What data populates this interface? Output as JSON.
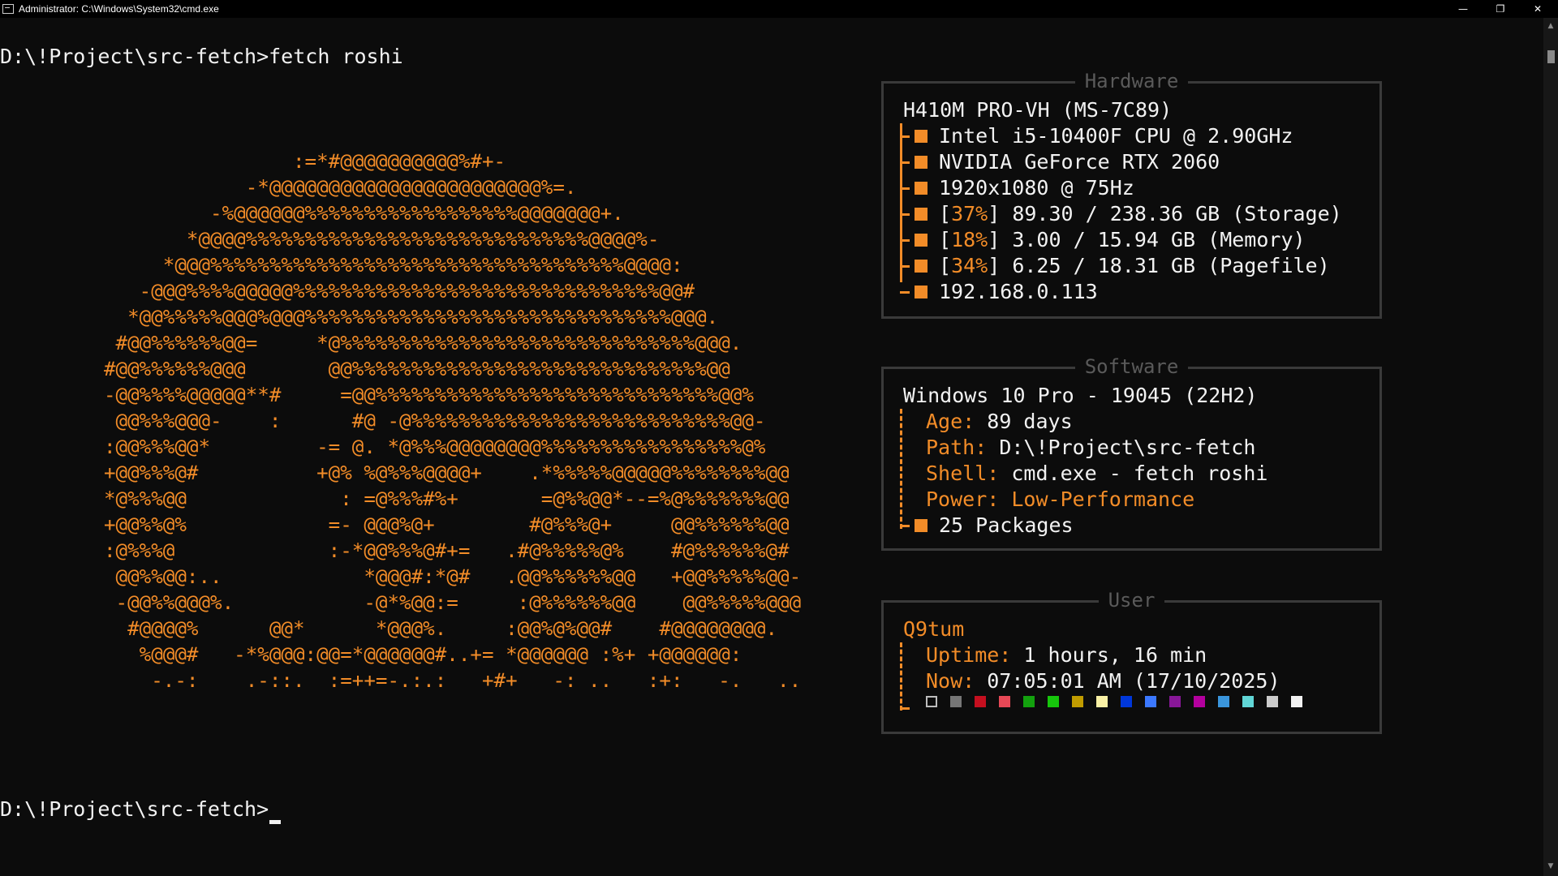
{
  "window": {
    "title": "Administrator: C:\\Windows\\System32\\cmd.exe",
    "min_glyph": "—",
    "max_glyph": "❐",
    "close_glyph": "✕"
  },
  "terminal": {
    "command_line": "D:\\!Project\\src-fetch>fetch roshi",
    "prompt": "D:\\!Project\\src-fetch>"
  },
  "ascii_art": "                :=*#@@@@@@@@@@%#+-\n            -*@@@@@@@@@@@@@@@@@@@@@@@%=.\n         -%@@@@@@%%%%%%%%%%%%%%%%%%@@@@@@@+.\n       *@@@@%%%%%%%%%%%%%%%%%%%%%%%%%%%%%@@@@%-\n     *@@@%%%%%%%%%%%%%%%%%%%%%%%%%%%%%%%%%%%@@@@:\n   -@@@%%%%@@@@@%%%%%%%%%%%%%%%%%%%%%%%%%%%%%%%@@#\n  *@@%%%%%@@@%@@@%%%%%%%%%%%%%%%%%%%%%%%%%%%%%%%@@@.\n #@@%%%%%%@@=     *@%%%%%%%%%%%%%%%%%%%%%%%%%%%%%%@@@.\n#@@%%%%%%@@@       @@%%%%%%%%%%%%%%%%%%%%%%%%%%%%%%@@\n-@@%%%%@@@@@**#     =@@%%%%%%%%%%%%%%%%%%%%%%%%%%%%%@@%\n @@%%%@@@-    :      #@ -@%%%%%%%%%%%%%%%%%%%%%%%%%%%@@-\n:@@%%%@@*         -= @. *@%%%@@@@@@@@%%%%%%%%%%%%%%%%%@%\n+@@%%%@#          +@% %@%%%@@@@+    .*%%%%%@@@@@%%%%%%%%@@\n*@%%%@@             : =@%%%#%+       =@%%@@*--=%@%%%%%%%@@\n+@@%%@%            =- @@@%@+        #@%%%@+     @@%%%%%%@@\n:@%%%@             :-*@@%%%@#+=   .#@%%%%%@%    #@%%%%%%@#\n @@%%@@:..            *@@@#:*@#   .@@%%%%%%@@   +@@%%%%%@@-\n -@@%%@@@%.           -@*%@@:=     :@%%%%%%@@    @@%%%%%@@@\n  #@@@@%      @@*      *@@@%.     :@@%@%@@#    #@@@@@@@@.\n   %@@@#   -*%@@@:@@=*@@@@@@#..+= *@@@@@@ :%+ +@@@@@@:\n    -.-:    .-::.  :=++=-.:.:   +#+   -: ..   :+:   -.   ..",
  "hardware": {
    "title": "Hardware",
    "board": "H410M PRO-VH (MS-7C89)",
    "cpu": "Intel i5-10400F CPU @ 2.90GHz",
    "gpu": "NVIDIA GeForce RTX 2060",
    "display": "1920x1080 @ 75Hz",
    "storage_pct": "37%",
    "storage": "89.30 / 238.36 GB (Storage)",
    "memory_pct": "18%",
    "memory": "3.00 / 15.94 GB (Memory)",
    "pagefile_pct": "34%",
    "pagefile": "6.25 / 18.31 GB (Pagefile)",
    "ip": "192.168.0.113"
  },
  "software": {
    "title": "Software",
    "os": "Windows 10 Pro - 19045 (22H2)",
    "age_label": "Age:",
    "age_value": "89 days",
    "path_label": "Path:",
    "path_value": "D:\\!Project\\src-fetch",
    "shell_label": "Shell:",
    "shell_value": "cmd.exe - fetch roshi",
    "power_label": "Power:",
    "power_value": "Low-Performance",
    "packages": "25 Packages"
  },
  "user": {
    "title": "User",
    "name": "Q9tum",
    "uptime_label": "Uptime:",
    "uptime_value": "1 hours, 16 min",
    "now_label": "Now:",
    "now_value": "07:05:01 AM (17/10/2025)"
  },
  "colors": {
    "accent": "#f28c28",
    "text": "#f2f2f2",
    "background": "#0c0c0c",
    "palette": [
      "#0c0c0c",
      "#767676",
      "#c50f1f",
      "#e74856",
      "#13a10e",
      "#16c60c",
      "#c19c00",
      "#f9f1a5",
      "#0037da",
      "#3b78ff",
      "#881798",
      "#b4009e",
      "#3a96dd",
      "#61d6d6",
      "#cccccc",
      "#f2f2f2"
    ]
  }
}
